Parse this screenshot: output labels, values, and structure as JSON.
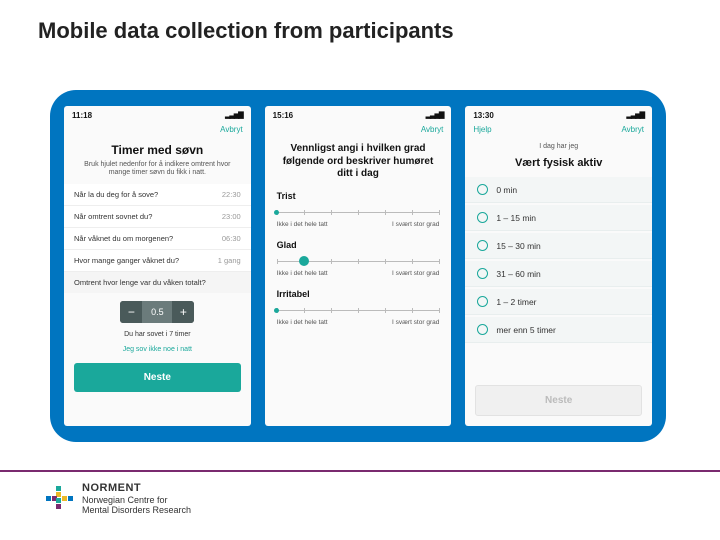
{
  "title": "Mobile data collection from participants",
  "footer": {
    "brand": "NORMENT",
    "line1": "Norwegian Centre for",
    "line2": "Mental Disorders Research"
  },
  "common": {
    "cancel": "Avbryt",
    "help": "Hjelp",
    "next": "Neste",
    "signal": "▂▃▅▇"
  },
  "s1": {
    "time": "11:18",
    "hdr": "Timer med søvn",
    "sub": "Bruk hjulet nedenfor for å indikere omtrent hvor mange timer søvn du fikk i natt.",
    "r1q": "Når la du deg for å sove?",
    "r1v": "22:30",
    "r2q": "Når omtrent sovnet du?",
    "r2v": "23:00",
    "r3q": "Når våknet du om morgenen?",
    "r3v": "06:30",
    "r4q": "Hvor mange ganger våknet du?",
    "r4v": "1 gang",
    "r5q": "Omtrent hvor lenge var du våken totalt?",
    "stepVal": "0.5",
    "hint": "Du har sovet i 7 timer",
    "skip": "Jeg sov ikke noe i natt"
  },
  "s2": {
    "time": "15:16",
    "hdr": "Vennligst angi i hvilken grad følgende ord beskriver humøret ditt i dag",
    "m1": "Trist",
    "m2": "Glad",
    "m3": "Irritabel",
    "endL": "Ikke i det hele tatt",
    "endR": "I svært stor grad"
  },
  "s3": {
    "time": "13:30",
    "lead": "I dag har jeg",
    "hdr": "Vært fysisk aktiv",
    "o1": "0 min",
    "o2": "1 – 15 min",
    "o3": "15 – 30 min",
    "o4": "31 – 60 min",
    "o5": "1 – 2 timer",
    "o6": "mer enn 5 timer"
  }
}
